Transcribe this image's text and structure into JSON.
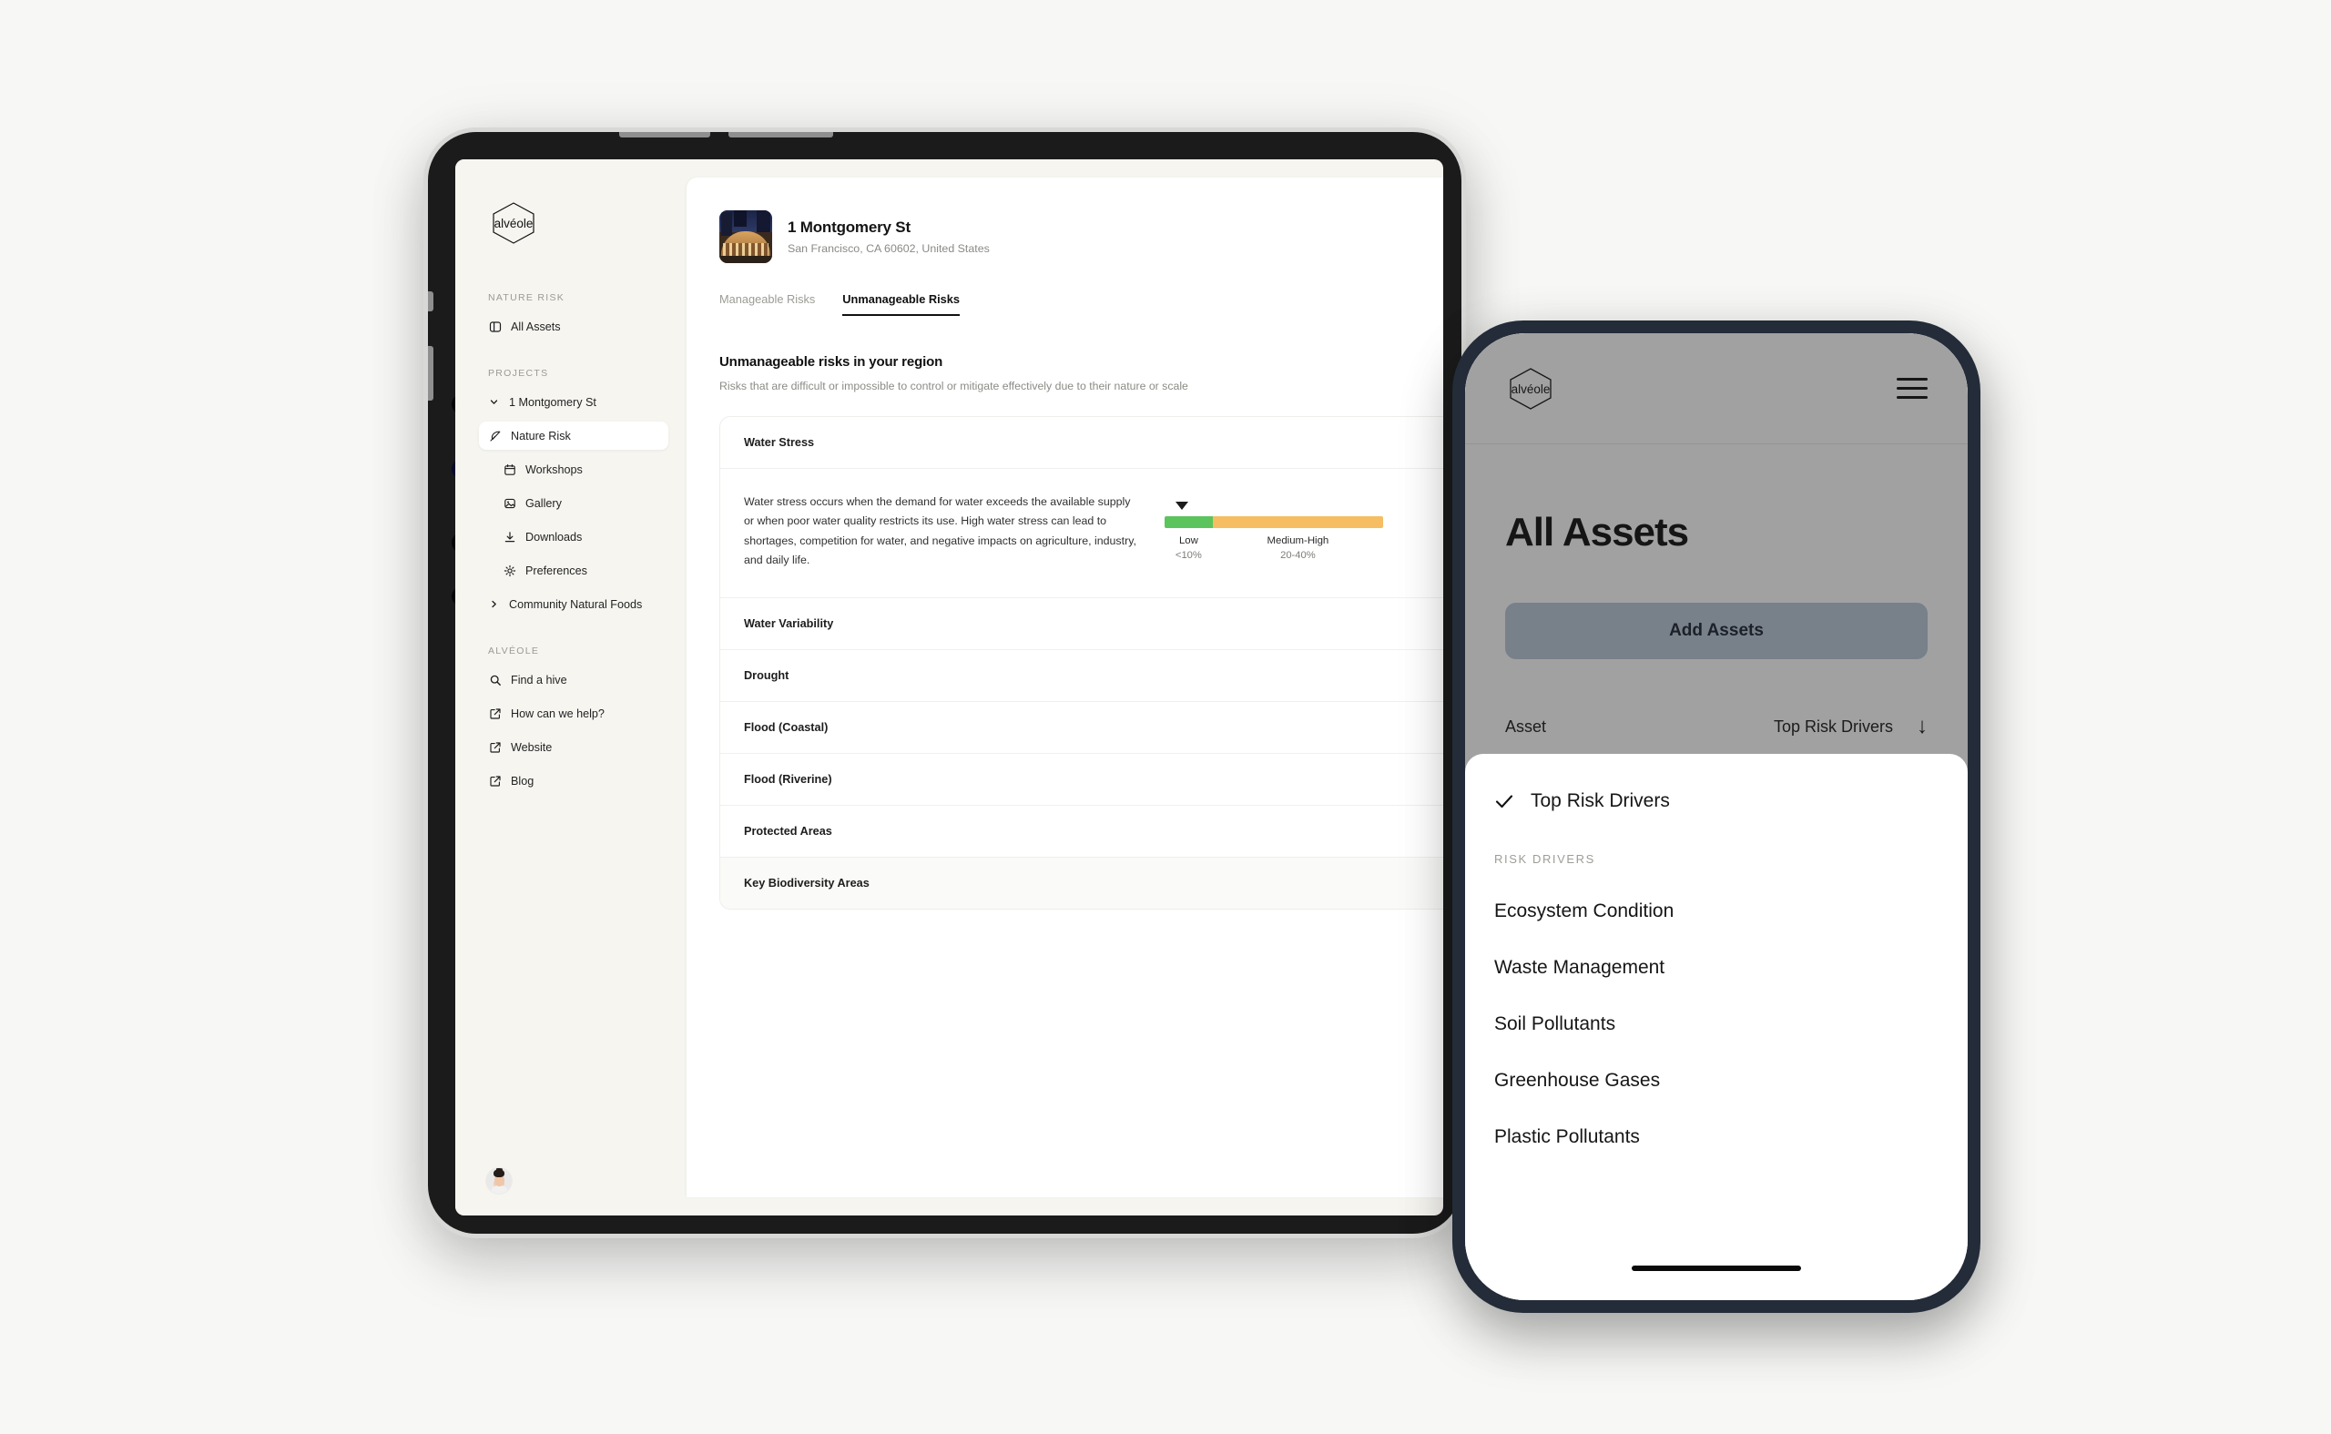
{
  "brand": {
    "logo_text": "alvéole",
    "accent": "#111111"
  },
  "tablet": {
    "sidebar": {
      "logo_text": "alvéole",
      "sections": [
        {
          "label": "NATURE RISK",
          "items": [
            {
              "label": "All Assets",
              "icon": "layers-icon",
              "active": false
            }
          ]
        },
        {
          "label": "PROJECTS",
          "items": [
            {
              "label": "1 Montgomery St",
              "icon": "chevron-down-icon",
              "active": false
            },
            {
              "label": "Nature Risk",
              "icon": "feather-icon",
              "active": true
            },
            {
              "label": "Workshops",
              "icon": "calendar-icon",
              "active": false
            },
            {
              "label": "Gallery",
              "icon": "image-icon",
              "active": false
            },
            {
              "label": "Downloads",
              "icon": "download-icon",
              "active": false
            },
            {
              "label": "Preferences",
              "icon": "gear-icon",
              "active": false
            },
            {
              "label": "Community Natural Foods",
              "icon": "chevron-right-icon",
              "active": false
            }
          ]
        },
        {
          "label": "ALVÉOLE",
          "items": [
            {
              "label": "Find a hive",
              "icon": "search-icon",
              "active": false
            },
            {
              "label": "How can we help?",
              "icon": "external-link-icon",
              "active": false
            },
            {
              "label": "Website",
              "icon": "external-link-icon",
              "active": false
            },
            {
              "label": "Blog",
              "icon": "external-link-icon",
              "active": false
            }
          ]
        }
      ]
    },
    "asset": {
      "title": "1 Montgomery St",
      "subtitle": "San Francisco, CA 60602, United States",
      "thumbnail_alt": "building-photo"
    },
    "tabs": [
      {
        "label": "Manageable Risks",
        "active": false
      },
      {
        "label": "Unmanageable Risks",
        "active": true
      }
    ],
    "section": {
      "title": "Unmanageable risks in your region",
      "description": "Risks that are difficult or impossible to control or mitigate effectively due to their nature or scale"
    },
    "risks": [
      {
        "name": "Water Stress",
        "expanded": true,
        "body": "Water stress occurs when the demand for water exceeds the available supply or when poor water quality restricts its use. High water stress can lead to shortages, competition for water, and negative impacts on agriculture, industry, and daily life.",
        "gauge": {
          "marker_position_pct": 8,
          "segments": [
            {
              "label": "Low",
              "range": "<10%",
              "color": "#5cc45c",
              "width_pct": 22
            },
            {
              "label": "Medium-High",
              "range": "20-40%",
              "color": "#f6bd63",
              "width_pct": 78
            }
          ]
        }
      },
      {
        "name": "Water Variability",
        "expanded": false
      },
      {
        "name": "Drought",
        "expanded": false
      },
      {
        "name": "Flood (Coastal)",
        "expanded": false
      },
      {
        "name": "Flood (Riverine)",
        "expanded": false
      },
      {
        "name": "Protected Areas",
        "expanded": false
      },
      {
        "name": "Key Biodiversity Areas",
        "expanded": false
      }
    ]
  },
  "phone": {
    "logo_text": "alvéole",
    "title": "All Assets",
    "add_button": "Add Assets",
    "table": {
      "col_asset": "Asset",
      "col_driver": "Top Risk Drivers",
      "sort_icon": "arrow-down-icon",
      "rows": [
        {
          "asset_thumb": "asset-thumbnail",
          "driver": "Ecosystem Condition"
        }
      ]
    },
    "sheet": {
      "selected_label": "Top Risk Drivers",
      "group_label": "RISK DRIVERS",
      "items": [
        "Ecosystem Condition",
        "Waste Management",
        "Soil Pollutants",
        "Greenhouse Gases",
        "Plastic Pollutants"
      ]
    }
  }
}
